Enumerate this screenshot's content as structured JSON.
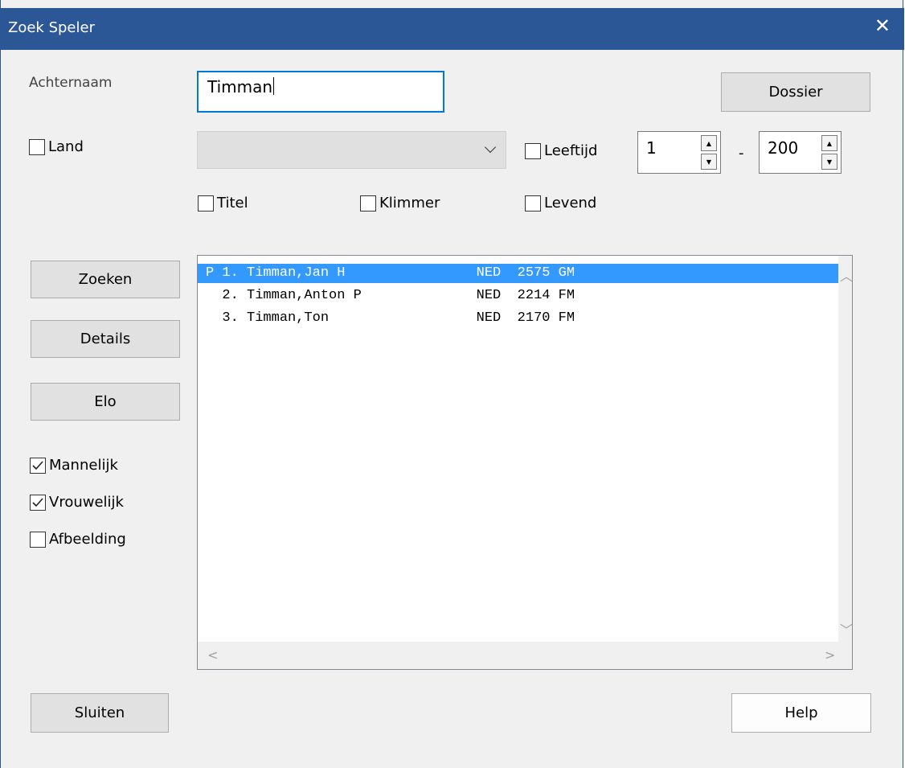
{
  "window": {
    "title": "Zoek Speler",
    "close_glyph": "✕"
  },
  "form": {
    "surname_label": "Achternaam",
    "surname_value": "Timman",
    "dossier_button": "Dossier",
    "land": {
      "label": "Land",
      "checked": false,
      "selected": ""
    },
    "age": {
      "label": "Leeftijd",
      "checked": false,
      "min": "1",
      "separator": "-",
      "max": "200"
    },
    "titel": {
      "label": "Titel",
      "checked": false
    },
    "klimmer": {
      "label": "Klimmer",
      "checked": false
    },
    "levend": {
      "label": "Levend",
      "checked": false
    }
  },
  "left_panel": {
    "zoeken": "Zoeken",
    "details": "Details",
    "elo": "Elo",
    "mannelijk": {
      "label": "Mannelijk",
      "checked": true
    },
    "vrouwelijk": {
      "label": "Vrouwelijk",
      "checked": true
    },
    "afbeelding": {
      "label": "Afbeelding",
      "checked": false
    }
  },
  "results": [
    {
      "text": "P 1. Timman,Jan H                NED  2575 GM",
      "selected": true
    },
    {
      "text": "  2. Timman,Anton P              NED  2214 FM",
      "selected": false
    },
    {
      "text": "  3. Timman,Ton                  NED  2170 FM",
      "selected": false
    }
  ],
  "footer": {
    "sluiten": "Sluiten",
    "help": "Help"
  },
  "colors": {
    "titlebar": "#2b5797",
    "selection": "#3399ff",
    "focus": "#0078d7"
  }
}
